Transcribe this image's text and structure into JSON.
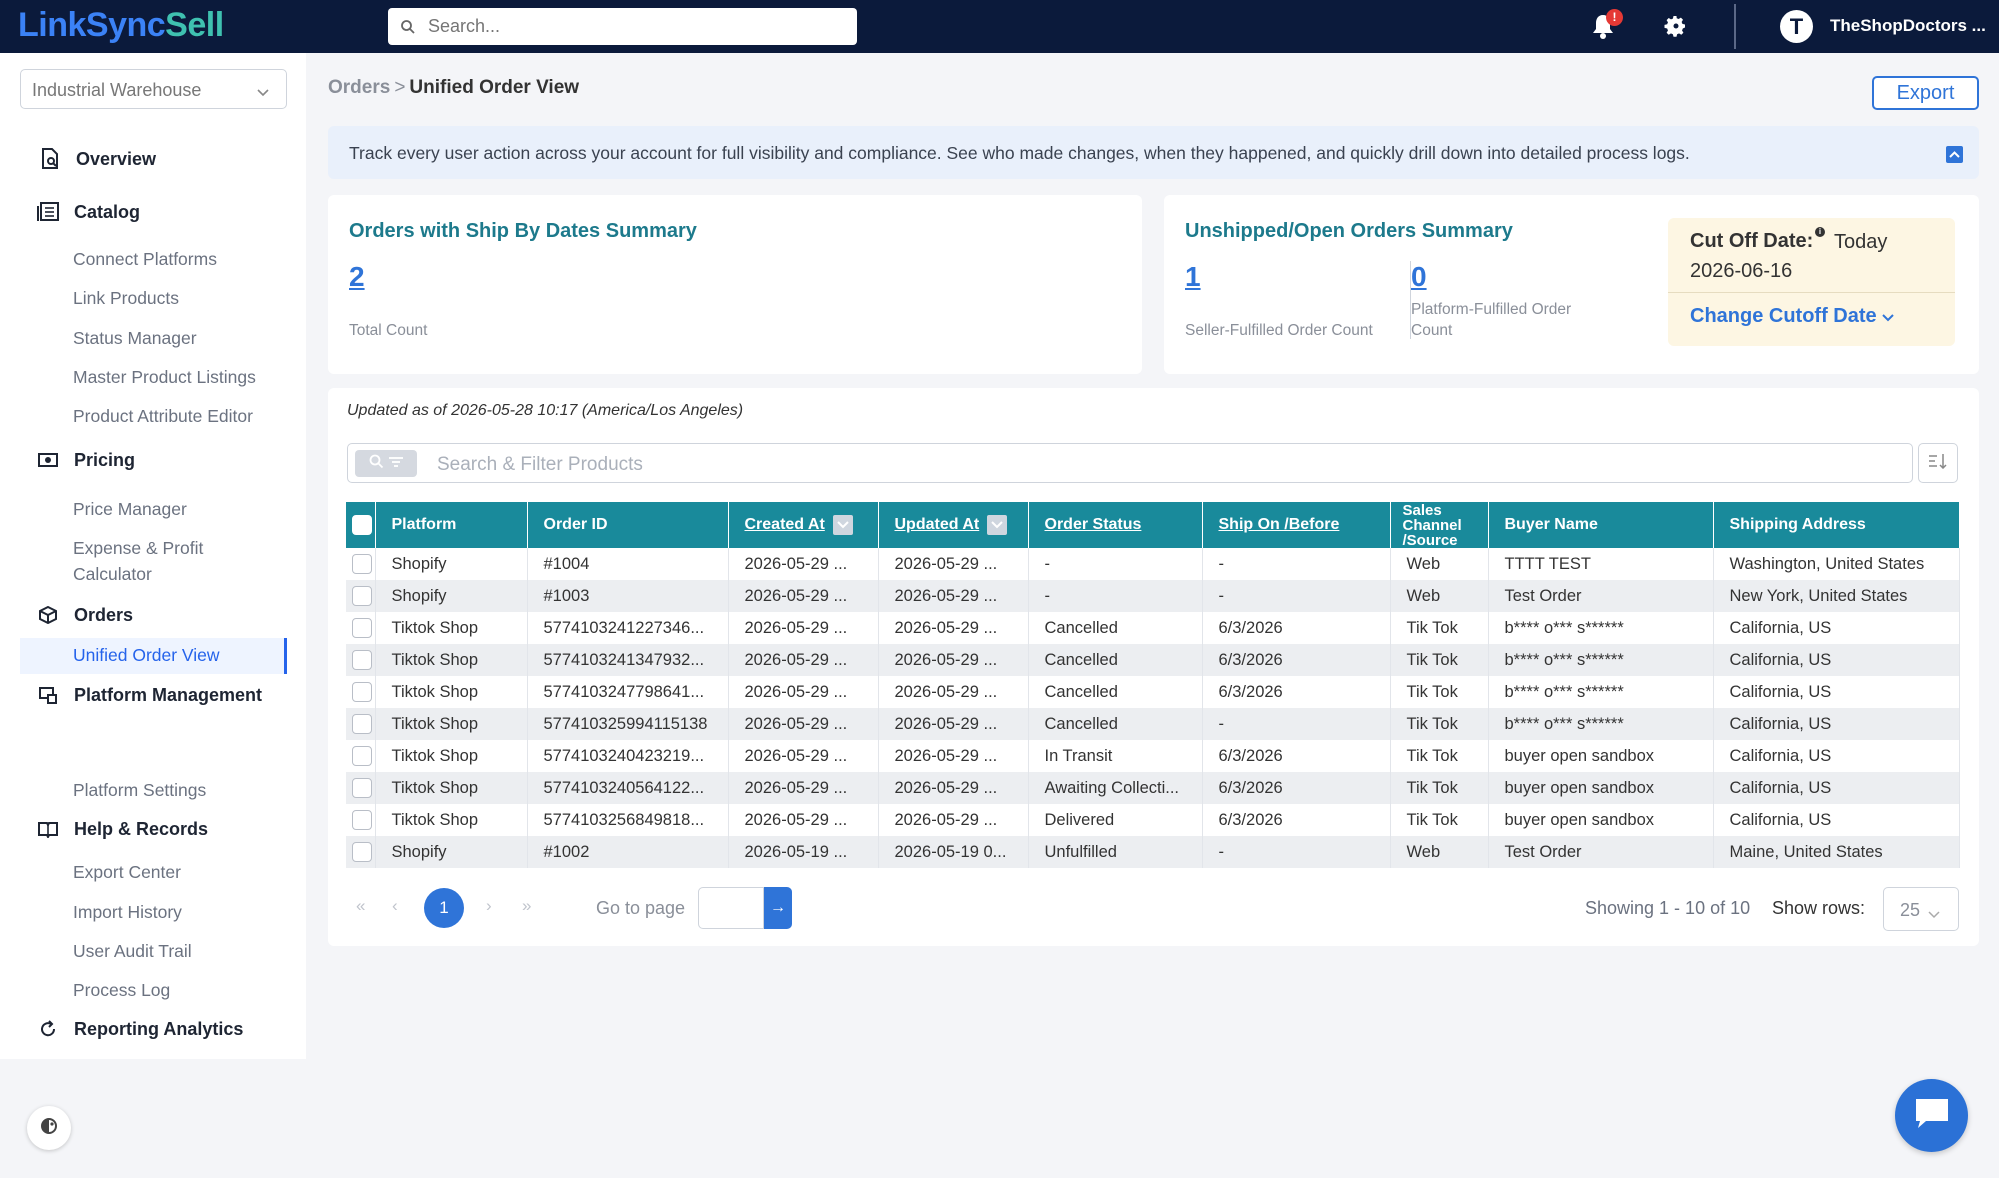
{
  "app": {
    "logo_part1": "Link",
    "logo_part2": "Sync",
    "logo_part3": "Sell",
    "search_placeholder": "Search...",
    "notification_badge": "!",
    "user_initial": "T",
    "user_name": "TheShopDoctors ..."
  },
  "sidebar": {
    "warehouse": "Industrial Warehouse",
    "sections": {
      "overview": "Overview",
      "catalog": "Catalog",
      "pricing": "Pricing",
      "orders": "Orders",
      "platform": "Platform Management",
      "help": "Help & Records",
      "reporting": "Reporting Analytics"
    },
    "catalog_items": [
      "Connect Platforms",
      "Link Products",
      "Status Manager",
      "Master Product Listings",
      "Product Attribute Editor"
    ],
    "pricing_items": [
      "Price Manager",
      "Expense & Profit",
      "Calculator"
    ],
    "orders_active": "Unified Order View",
    "platform_items": [
      "Platform Settings"
    ],
    "help_items": [
      "Export Center",
      "Import History",
      "User Audit Trail",
      "Process Log"
    ]
  },
  "breadcrumb": {
    "parent": "Orders",
    "separator": ">",
    "current": "Unified Order View"
  },
  "export_label": "Export",
  "info_banner": "Track every user action across your account for full visibility and compliance. See who made changes, when they happened, and quickly drill down into detailed process logs.",
  "summary_ship": {
    "title": "Orders with Ship By Dates Summary",
    "count": "2",
    "count_label": "Total Count"
  },
  "summary_open": {
    "title": "Unshipped/Open Orders Summary",
    "seller_count": "1",
    "seller_label": "Seller-Fulfilled Order Count",
    "platform_count": "0",
    "platform_label_1": "Platform-Fulfilled Order",
    "platform_label_2": "Count"
  },
  "cutoff": {
    "label": "Cut Off Date:",
    "info": "i",
    "today": "Today",
    "date": "2026-06-16",
    "change_label": "Change Cutoff Date"
  },
  "updated_as_of": "Updated as of 2026-05-28 10:17 (America/Los Angeles)",
  "filter_placeholder": "Search & Filter Products",
  "table": {
    "headers": {
      "platform": "Platform",
      "order_id": "Order ID",
      "created_at": "Created At",
      "updated_at": "Updated At",
      "order_status": "Order Status",
      "ship_on": "Ship On /Before",
      "sales_channel": "Sales Channel /Source",
      "buyer_name": "Buyer Name",
      "shipping_address": "Shipping Address"
    },
    "rows": [
      [
        "Shopify",
        "#1004",
        "2026-05-29 ...",
        "2026-05-29 ...",
        "-",
        "-",
        "Web",
        "TTTT TEST",
        "Washington, United States"
      ],
      [
        "Shopify",
        "#1003",
        "2026-05-29 ...",
        "2026-05-29 ...",
        "-",
        "-",
        "Web",
        "Test Order",
        "New York, United States"
      ],
      [
        "Tiktok Shop",
        "5774103241227346...",
        "2026-05-29 ...",
        "2026-05-29 ...",
        "Cancelled",
        "6/3/2026",
        "Tik Tok",
        "b**** o*** s******",
        "California, US"
      ],
      [
        "Tiktok Shop",
        "5774103241347932...",
        "2026-05-29 ...",
        "2026-05-29 ...",
        "Cancelled",
        "6/3/2026",
        "Tik Tok",
        "b**** o*** s******",
        "California, US"
      ],
      [
        "Tiktok Shop",
        "5774103247798641...",
        "2026-05-29 ...",
        "2026-05-29 ...",
        "Cancelled",
        "6/3/2026",
        "Tik Tok",
        "b**** o*** s******",
        "California, US"
      ],
      [
        "Tiktok Shop",
        "577410325994115138",
        "2026-05-29 ...",
        "2026-05-29 ...",
        "Cancelled",
        "-",
        "Tik Tok",
        "b**** o*** s******",
        "California, US"
      ],
      [
        "Tiktok Shop",
        "5774103240423219...",
        "2026-05-29 ...",
        "2026-05-29 ...",
        "In Transit",
        "6/3/2026",
        "Tik Tok",
        "buyer open sandbox",
        "California, US"
      ],
      [
        "Tiktok Shop",
        "5774103240564122...",
        "2026-05-29 ...",
        "2026-05-29 ...",
        "Awaiting Collecti...",
        "6/3/2026",
        "Tik Tok",
        "buyer open sandbox",
        "California, US"
      ],
      [
        "Tiktok Shop",
        "5774103256849818...",
        "2026-05-29 ...",
        "2026-05-29 ...",
        "Delivered",
        "6/3/2026",
        "Tik Tok",
        "buyer open sandbox",
        "California, US"
      ],
      [
        "Shopify",
        "#1002",
        "2026-05-19 ...",
        "2026-05-19 0...",
        "Unfulfilled",
        "-",
        "Web",
        "Test Order",
        "Maine, United States"
      ]
    ]
  },
  "pagination": {
    "first": "«",
    "prev": "‹",
    "current_page": "1",
    "next": "›",
    "last": "»",
    "goto_label": "Go to page",
    "goto_button": "→",
    "showing": "Showing 1 - 10 of 10",
    "rows_label": "Show rows:",
    "rows_value": "25"
  }
}
